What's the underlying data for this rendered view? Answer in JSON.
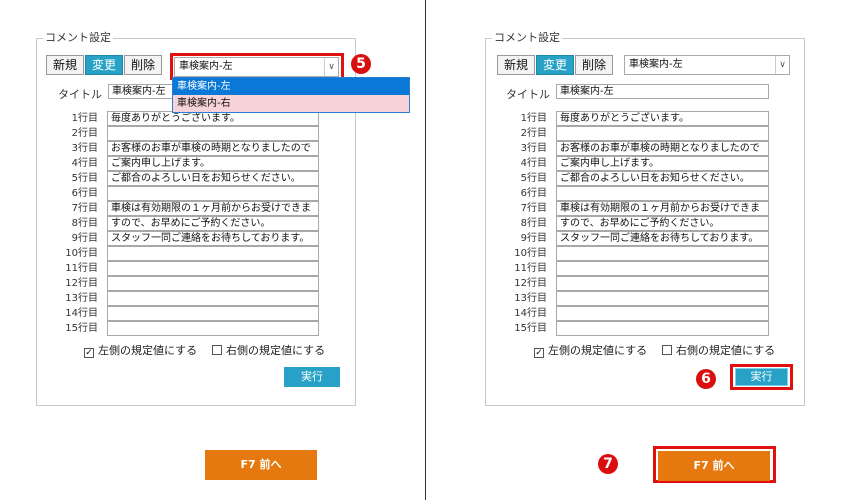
{
  "group_title": "コメント設定",
  "buttons": {
    "new": "新規",
    "change": "変更",
    "delete": "削除"
  },
  "template_select": {
    "value": "車検案内-左",
    "arrow": "∨"
  },
  "dropdown_options": [
    "車検案内-左",
    "車検案内-右"
  ],
  "title_label": "タイトル",
  "title_value": "車検案内-左",
  "rows": [
    {
      "label": "1行目",
      "text": "毎度ありがとうございます。"
    },
    {
      "label": "2行目",
      "text": ""
    },
    {
      "label": "3行目",
      "text": "お客様のお車が車検の時期となりましたので"
    },
    {
      "label": "4行目",
      "text": "ご案内申し上げます。"
    },
    {
      "label": "5行目",
      "text": "ご都合のよろしい日をお知らせください。"
    },
    {
      "label": "6行目",
      "text": ""
    },
    {
      "label": "7行目",
      "text": "車検は有効期限の１ヶ月前からお受けできま"
    },
    {
      "label": "8行目",
      "text": "すので、お早めにご予約ください。"
    },
    {
      "label": "9行目",
      "text": "スタッフ一同ご連絡をお待ちしております。"
    },
    {
      "label": "10行目",
      "text": ""
    },
    {
      "label": "11行目",
      "text": ""
    },
    {
      "label": "12行目",
      "text": ""
    },
    {
      "label": "13行目",
      "text": ""
    },
    {
      "label": "14行目",
      "text": ""
    },
    {
      "label": "15行目",
      "text": ""
    }
  ],
  "checkbox_left": {
    "label": "左側の規定値にする",
    "checked": true,
    "mark": "☑"
  },
  "checkbox_right": {
    "label": "右側の規定値にする",
    "checked": false
  },
  "execute_label": "実行",
  "prev_label": "F7 前へ",
  "badges": {
    "step5": "5",
    "step6": "6",
    "step7": "7"
  },
  "colors": {
    "accent": "#27a2c6",
    "highlight": "#e01010",
    "prev_button": "#e5790f",
    "badge": "#d90f0f"
  }
}
